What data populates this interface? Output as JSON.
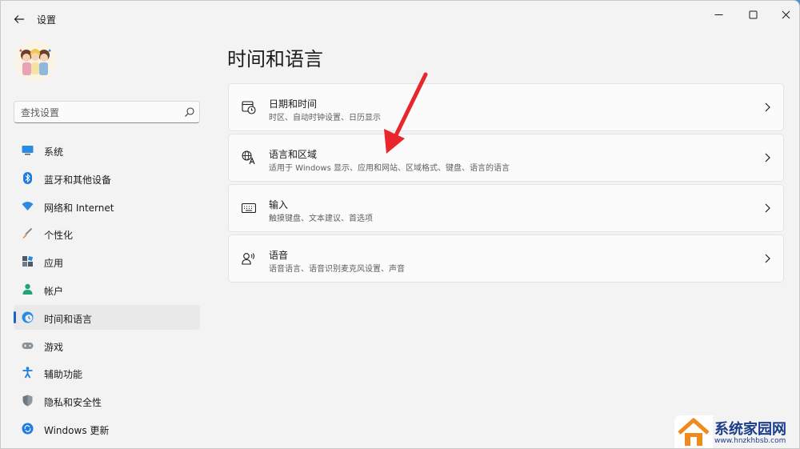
{
  "window": {
    "title": "设置"
  },
  "search": {
    "placeholder": "查找设置"
  },
  "sidebar": {
    "items": [
      {
        "label": "系统",
        "icon": "monitor-icon"
      },
      {
        "label": "蓝牙和其他设备",
        "icon": "bluetooth-icon"
      },
      {
        "label": "网络和 Internet",
        "icon": "wifi-icon"
      },
      {
        "label": "个性化",
        "icon": "brush-icon"
      },
      {
        "label": "应用",
        "icon": "apps-icon"
      },
      {
        "label": "帐户",
        "icon": "person-icon"
      },
      {
        "label": "时间和语言",
        "icon": "globe-clock-icon",
        "selected": true
      },
      {
        "label": "游戏",
        "icon": "gamepad-icon"
      },
      {
        "label": "辅助功能",
        "icon": "accessibility-icon"
      },
      {
        "label": "隐私和安全性",
        "icon": "shield-icon"
      },
      {
        "label": "Windows 更新",
        "icon": "update-icon"
      }
    ]
  },
  "main": {
    "title": "时间和语言",
    "cards": [
      {
        "title": "日期和时间",
        "subtitle": "时区、自动时钟设置、日历显示",
        "icon": "calendar-clock-icon"
      },
      {
        "title": "语言和区域",
        "subtitle": "适用于 Windows 显示、应用和网站、区域格式、键盘、语言的语言",
        "icon": "language-icon"
      },
      {
        "title": "输入",
        "subtitle": "触摸键盘、文本建议、首选项",
        "icon": "keyboard-icon"
      },
      {
        "title": "语音",
        "subtitle": "语音语言、语音识别麦克风设置、声音",
        "icon": "speech-icon"
      }
    ]
  },
  "watermark": {
    "name": "系统家园网",
    "url": "www.hnzkhbsb.com"
  },
  "colors": {
    "accent": "#1a66c8",
    "annotation_arrow": "#e8262b",
    "watermark": "#1c3e8a"
  }
}
